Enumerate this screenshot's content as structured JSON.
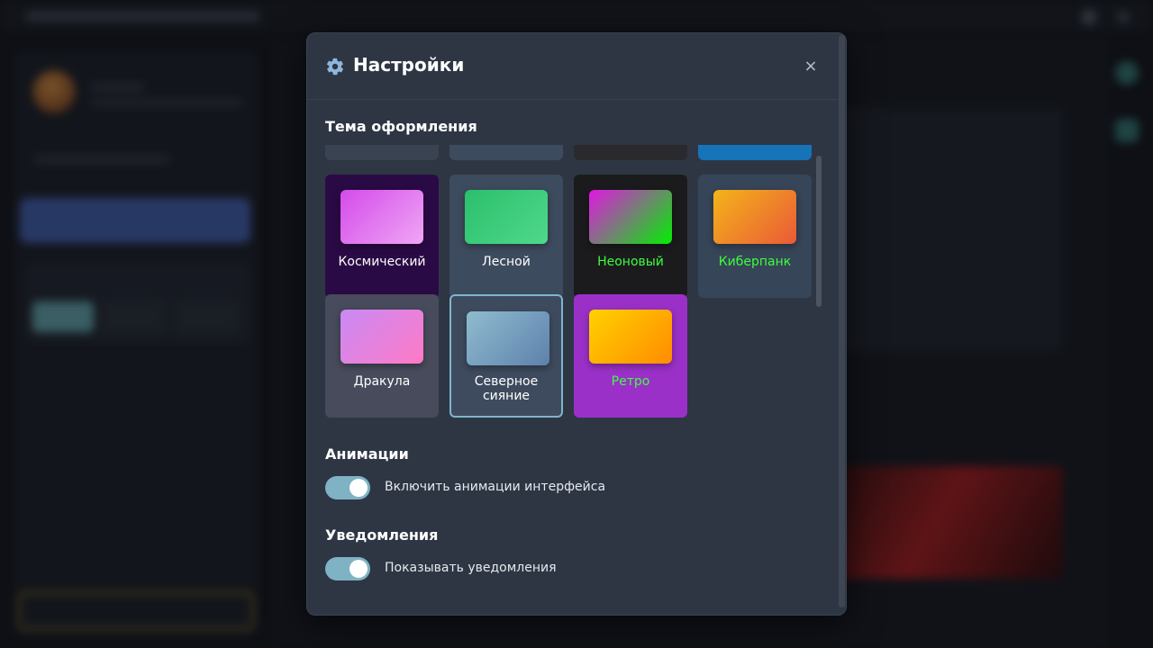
{
  "modal": {
    "title": "Настройки",
    "close_label": "×",
    "theme_section_title": "Тема оформления",
    "themes": [
      {
        "name": "",
        "swatch": "#3a4352",
        "tile_bg": "#3a4352",
        "label_color": "#ffffff"
      },
      {
        "name": "",
        "swatch": "#3d4b5e",
        "tile_bg": "#3d4b5e",
        "label_color": "#ffffff"
      },
      {
        "name": "",
        "swatch": "#2a2a2e",
        "tile_bg": "#2a2a2e",
        "label_color": "#ffffff"
      },
      {
        "name": "",
        "swatch": "#1673b8",
        "tile_bg": "#1673b8",
        "label_color": "#ffffff"
      },
      {
        "name": "Космический",
        "swatch": "linear-gradient(135deg, #d44bea, #f0a6f5)",
        "tile_bg": "#2a0a45",
        "label_color": "#ffffff"
      },
      {
        "name": "Лесной",
        "swatch": "linear-gradient(135deg, #2bbf6c, #4fd98a)",
        "tile_bg": "#3d4b5e",
        "label_color": "#ffffff"
      },
      {
        "name": "Неоновый",
        "swatch": "linear-gradient(135deg, #e316e3, #00f000)",
        "tile_bg": "#1b1b1d",
        "label_color": "#3dff3d"
      },
      {
        "name": "Киберпанк",
        "swatch": "linear-gradient(135deg, #f4b41a, #ea5a37)",
        "tile_bg": "#364558",
        "label_color": "#3dff3d"
      },
      {
        "name": "Дракула",
        "swatch": "linear-gradient(135deg, #c98af5, #ff7ac6)",
        "tile_bg": "#474b5c",
        "label_color": "#ffffff"
      },
      {
        "name": "Северное сияние",
        "swatch": "linear-gradient(135deg, #8fbccf, #5e81ac)",
        "tile_bg": "#3e4b5e",
        "label_color": "#ffffff",
        "selected": true
      },
      {
        "name": "Ретро",
        "swatch": "linear-gradient(135deg, #ffd100, #ff8c00)",
        "tile_bg": "#9b30c9",
        "label_color": "#3dff3d"
      }
    ],
    "animations_title": "Анимации",
    "animations_toggle_label": "Включить анимации интерфейса",
    "animations_enabled": true,
    "notifications_title": "Уведомления",
    "notifications_toggle_label": "Показывать уведомления",
    "notifications_enabled": true
  }
}
